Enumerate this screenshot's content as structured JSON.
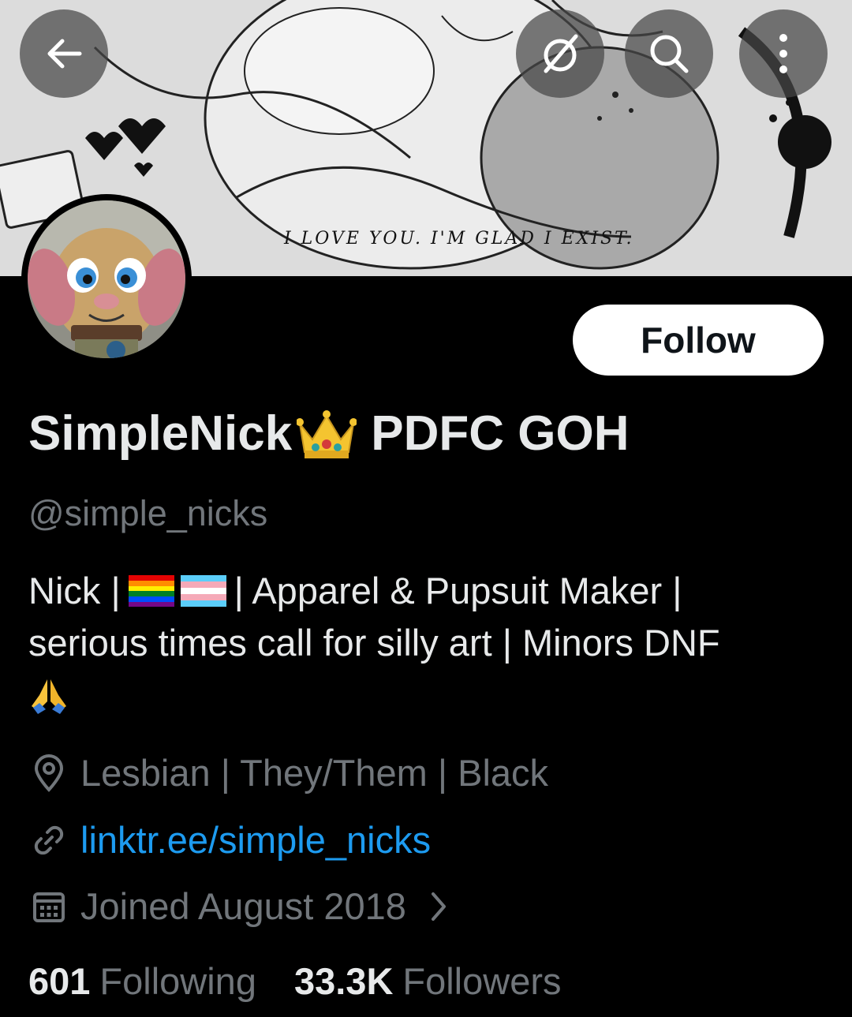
{
  "banner": {
    "caption": "I LOVE YOU. I'M GLAD I EXIST."
  },
  "top_bar": {
    "back_icon": "arrow-left-icon",
    "grok_icon": "slashed-circle-icon",
    "search_icon": "search-icon",
    "more_icon": "more-vertical-icon"
  },
  "profile": {
    "follow_label": "Follow",
    "display_name": "SimpleNick",
    "display_name_suffix": "PDFC GOH",
    "handle": "@simple_nicks",
    "bio": {
      "line1_a": "Nick |",
      "line1_b": "| Apparel & Pupsuit Maker |",
      "line2": "serious times call for silly art | Minors DNF"
    },
    "location": "Lesbian | They/Them | Black",
    "website": "linktr.ee/simple_nicks",
    "joined": "Joined August 2018",
    "following_count": "601",
    "following_label": "Following",
    "followers_count": "33.3K",
    "followers_label": "Followers"
  },
  "colors": {
    "background": "#000000",
    "text_primary": "#e7e9ea",
    "text_secondary": "#71767b",
    "link": "#1d9bf0",
    "follow_button_bg": "#ffffff"
  }
}
